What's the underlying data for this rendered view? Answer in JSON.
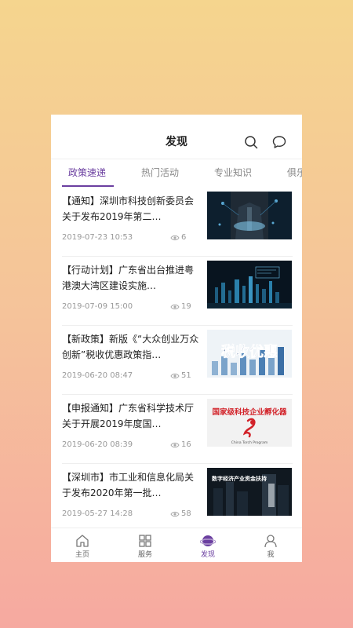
{
  "header": {
    "title": "发现"
  },
  "tabs": [
    {
      "label": "政策速递",
      "active": true
    },
    {
      "label": "热门活动",
      "active": false
    },
    {
      "label": "专业知识",
      "active": false
    },
    {
      "label": "俱乐",
      "active": false
    }
  ],
  "articles": [
    {
      "title": "【通知】深圳市科技创新委员会关于发布2019年第二…",
      "date": "2019-07-23 10:53",
      "views": "6",
      "thumb": "tech-handshake"
    },
    {
      "title": "【行动计划】广东省出台推进粤港澳大湾区建设实施…",
      "date": "2019-07-09 15:00",
      "views": "19",
      "thumb": "data-city"
    },
    {
      "title": "【新政策】新版《“大众创业万众创新”税收优惠政策指…",
      "date": "2019-06-20 08:47",
      "views": "51",
      "thumb": "tax-benefit",
      "thumb_text": "税收优惠"
    },
    {
      "title": "【申报通知】广东省科学技术厅关于开展2019年度国…",
      "date": "2019-06-20 08:39",
      "views": "16",
      "thumb": "incubator",
      "thumb_text": "国家级科技企业孵化器",
      "thumb_subtext": "China Torch Program"
    },
    {
      "title": "【深圳市】市工业和信息化局关于发布2020年第一批…",
      "date": "2019-05-27 14:28",
      "views": "58",
      "thumb": "digital-economy",
      "thumb_text": "数字经济产业资金扶持"
    }
  ],
  "bottom_nav": [
    {
      "label": "主页",
      "icon": "home-icon",
      "active": false
    },
    {
      "label": "服务",
      "icon": "grid-icon",
      "active": false
    },
    {
      "label": "发现",
      "icon": "planet-icon",
      "active": true
    },
    {
      "label": "我",
      "icon": "user-icon",
      "active": false
    }
  ],
  "colors": {
    "accent": "#6b3fa0",
    "text": "#222222",
    "muted": "#999999"
  }
}
